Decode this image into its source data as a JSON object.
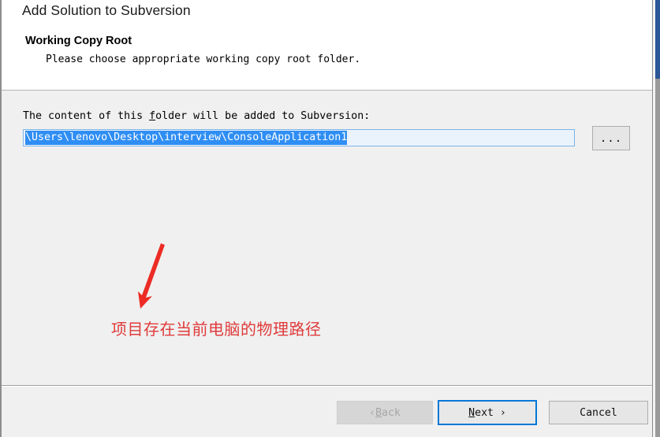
{
  "window": {
    "title": "Add Solution to Subversion"
  },
  "header": {
    "section_heading": "Working Copy Root",
    "section_subtitle": "Please choose appropriate working copy root folder."
  },
  "main": {
    "field_label_before": "The content of this ",
    "field_label_accesskey": "f",
    "field_label_after": "older will be added to Subversion:",
    "path_value": "\\Users\\lenovo\\Desktop\\interview\\ConsoleApplication1",
    "path_placeholder": "",
    "browse_label": "...",
    "selection_color": "#2f8ef4",
    "input_border_color": "#7eb4ea"
  },
  "annotation": {
    "text": "项目存在当前电脑的物理路径",
    "color": "#e03b3b",
    "arrow_color": "#ec2b24"
  },
  "footer": {
    "back_prefix": "‹ ",
    "back_accesskey": "B",
    "back_suffix": "ack",
    "next_accesskey": "N",
    "next_suffix": "ext ›",
    "cancel_label": "Cancel",
    "focus_color": "#0078d7"
  }
}
